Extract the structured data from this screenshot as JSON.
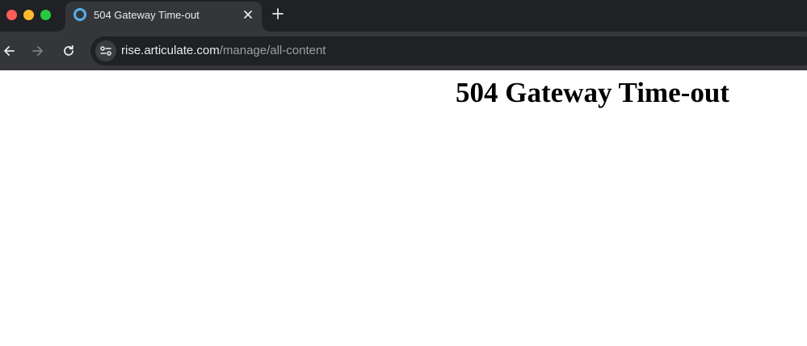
{
  "window": {
    "controls": [
      "close",
      "minimize",
      "maximize"
    ]
  },
  "tab": {
    "title": "504 Gateway Time-out",
    "favicon": "loading-ring-icon",
    "favicon_color": "#4fb3e8"
  },
  "toolbar": {
    "url_host": "rise.articulate.com",
    "url_path": "/manage/all-content"
  },
  "page": {
    "heading": "504 Gateway Time-out"
  },
  "colors": {
    "tabstrip_bg": "#202124",
    "toolbar_bg": "#35363a",
    "omnibox_bg": "#202124",
    "page_bg": "#ffffff"
  }
}
